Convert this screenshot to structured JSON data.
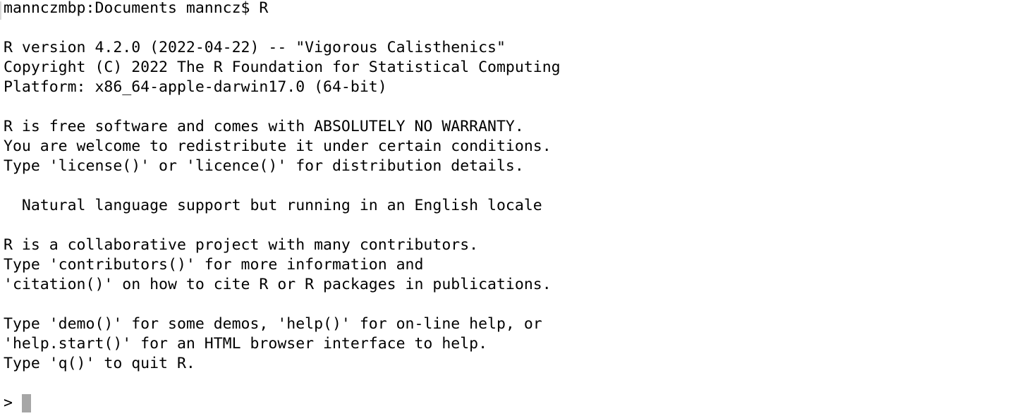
{
  "terminal": {
    "shell_prompt": "mannczmbp:Documents manncz$ R",
    "lines": [
      "R version 4.2.0 (2022-04-22) -- \"Vigorous Calisthenics\"",
      "Copyright (C) 2022 The R Foundation for Statistical Computing",
      "Platform: x86_64-apple-darwin17.0 (64-bit)",
      "",
      "R is free software and comes with ABSOLUTELY NO WARRANTY.",
      "You are welcome to redistribute it under certain conditions.",
      "Type 'license()' or 'licence()' for distribution details.",
      "",
      "  Natural language support but running in an English locale",
      "",
      "R is a collaborative project with many contributors.",
      "Type 'contributors()' for more information and",
      "'citation()' on how to cite R or R packages in publications.",
      "",
      "Type 'demo()' for some demos, 'help()' for on-line help, or",
      "'help.start()' for an HTML browser interface to help.",
      "Type 'q()' to quit R.",
      ""
    ],
    "r_prompt": "> ",
    "input_value": "",
    "colors": {
      "background": "#ffffff",
      "foreground": "#000000",
      "cursor": "#a6a6a6"
    }
  }
}
